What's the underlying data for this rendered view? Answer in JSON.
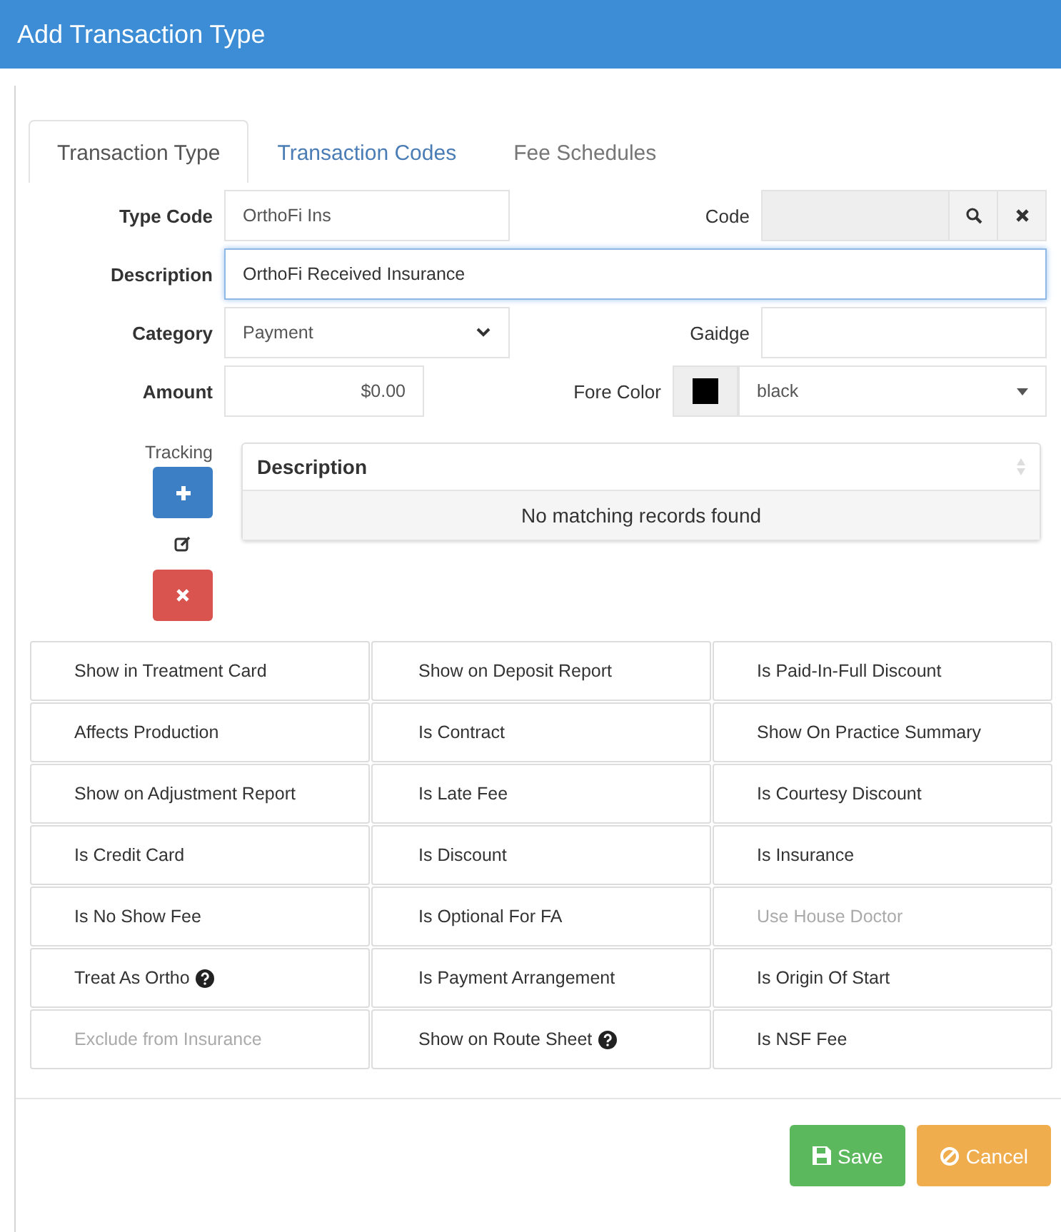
{
  "window": {
    "title": "Add Transaction Type"
  },
  "tabs": [
    {
      "label": "Transaction Type",
      "selected": true
    },
    {
      "label": "Transaction Codes",
      "selected": false
    },
    {
      "label": "Fee Schedules",
      "selected": false
    }
  ],
  "form": {
    "type_code": {
      "label": "Type Code",
      "value": "OrthoFi Ins"
    },
    "code": {
      "label": "Code",
      "disabled": true
    },
    "description": {
      "label": "Description",
      "value": "OrthoFi Received Insurance",
      "focused": true
    },
    "category": {
      "label": "Category",
      "value": "Payment"
    },
    "gaidge": {
      "label": "Gaidge"
    },
    "amount": {
      "label": "Amount",
      "value": "$0.00"
    },
    "fore_color": {
      "label": "Fore Color",
      "value": "black",
      "color": "#000000"
    }
  },
  "tracking": {
    "label": "Tracking",
    "columns": [
      "Description"
    ],
    "empty_message": "No matching records found"
  },
  "toggles": [
    {
      "label": "Show in Treatment Card",
      "disabled": false,
      "help": false
    },
    {
      "label": "Show on Deposit Report",
      "disabled": false,
      "help": false
    },
    {
      "label": "Is Paid-In-Full Discount",
      "disabled": false,
      "help": false
    },
    {
      "label": "Affects Production",
      "disabled": false,
      "help": false
    },
    {
      "label": "Is Contract",
      "disabled": false,
      "help": false
    },
    {
      "label": "Show On Practice Summary",
      "disabled": false,
      "help": false
    },
    {
      "label": "Show on Adjustment Report",
      "disabled": false,
      "help": false
    },
    {
      "label": "Is Late Fee",
      "disabled": false,
      "help": false
    },
    {
      "label": "Is Courtesy Discount",
      "disabled": false,
      "help": false
    },
    {
      "label": "Is Credit Card",
      "disabled": false,
      "help": false
    },
    {
      "label": "Is Discount",
      "disabled": false,
      "help": false
    },
    {
      "label": "Is Insurance",
      "disabled": false,
      "help": false
    },
    {
      "label": "Is No Show Fee",
      "disabled": false,
      "help": false
    },
    {
      "label": "Is Optional For FA",
      "disabled": false,
      "help": false
    },
    {
      "label": "Use House Doctor",
      "disabled": true,
      "help": false
    },
    {
      "label": "Treat As Ortho",
      "disabled": false,
      "help": true
    },
    {
      "label": "Is Payment Arrangement",
      "disabled": false,
      "help": false
    },
    {
      "label": "Is Origin Of Start",
      "disabled": false,
      "help": false
    },
    {
      "label": "Exclude from Insurance",
      "disabled": true,
      "help": false
    },
    {
      "label": "Show on Route Sheet",
      "disabled": false,
      "help": true
    },
    {
      "label": "Is NSF Fee",
      "disabled": false,
      "help": false
    }
  ],
  "buttons": [
    {
      "label": "Save",
      "kind": "save"
    },
    {
      "label": "Cancel",
      "kind": "cancel"
    }
  ]
}
